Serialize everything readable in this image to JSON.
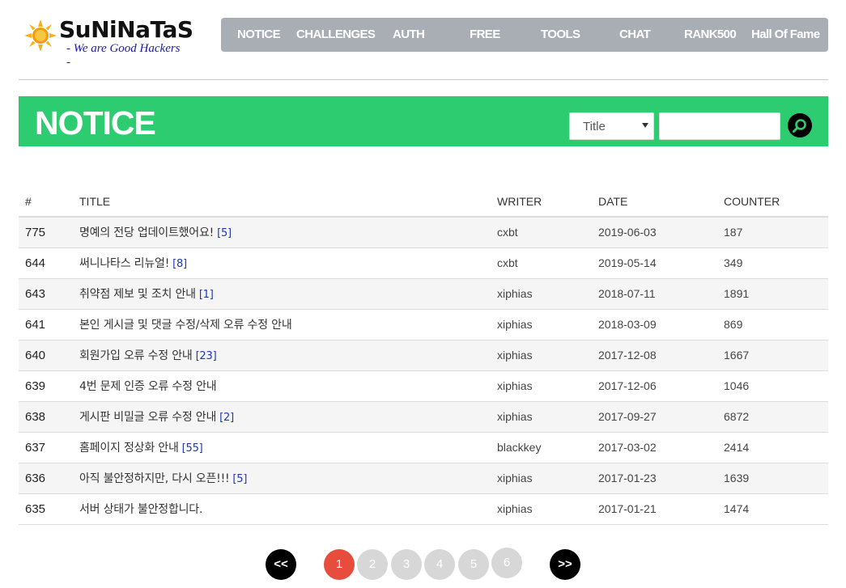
{
  "site": {
    "brand": "SuNiNaTaS",
    "tagline": "- We are Good Hackers -"
  },
  "nav": {
    "items": [
      "NOTICE",
      "CHALLENGES",
      "AUTH",
      "FREE",
      "TOOLS",
      "CHAT",
      "RANK500",
      "Hall Of Fame"
    ]
  },
  "page": {
    "title": "NOTICE"
  },
  "search": {
    "field_selected": "Title",
    "query": ""
  },
  "table": {
    "headers": [
      "#",
      "TITLE",
      "WRITER",
      "DATE",
      "COUNTER"
    ],
    "rows": [
      {
        "num": "775",
        "title": "명예의 전당 업데이트했어요!",
        "comments": "[5]",
        "writer": "cxbt",
        "date": "2019-06-03",
        "counter": "187"
      },
      {
        "num": "644",
        "title": "써니나타스 리뉴얼!",
        "comments": "[8]",
        "writer": "cxbt",
        "date": "2019-05-14",
        "counter": "349"
      },
      {
        "num": "643",
        "title": "취약점 제보 및 조치 안내",
        "comments": "[1]",
        "writer": "xiphias",
        "date": "2018-07-11",
        "counter": "1891"
      },
      {
        "num": "641",
        "title": "본인 게시글 및 댓글 수정/삭제 오류 수정 안내",
        "comments": "",
        "writer": "xiphias",
        "date": "2018-03-09",
        "counter": "869"
      },
      {
        "num": "640",
        "title": "회원가입 오류 수정 안내",
        "comments": "[23]",
        "writer": "xiphias",
        "date": "2017-12-08",
        "counter": "1667"
      },
      {
        "num": "639",
        "title": "4번 문제 인증 오류 수정 안내",
        "comments": "",
        "writer": "xiphias",
        "date": "2017-12-06",
        "counter": "1046"
      },
      {
        "num": "638",
        "title": "게시판 비밀글 오류 수정 안내",
        "comments": "[2]",
        "writer": "xiphias",
        "date": "2017-09-27",
        "counter": "6872"
      },
      {
        "num": "637",
        "title": "홈페이지 정상화 안내",
        "comments": "[55]",
        "writer": "blackkey",
        "date": "2017-03-02",
        "counter": "2414"
      },
      {
        "num": "636",
        "title": "아직 불안정하지만, 다시 오픈!!!",
        "comments": "[5]",
        "writer": "xiphias",
        "date": "2017-01-23",
        "counter": "1639"
      },
      {
        "num": "635",
        "title": "서버 상태가 불안정합니다.",
        "comments": "",
        "writer": "xiphias",
        "date": "2017-01-21",
        "counter": "1474"
      }
    ]
  },
  "pagination": {
    "prev": "<<",
    "next": ">>",
    "pages": [
      "1",
      "2",
      "3",
      "4",
      "5",
      "6"
    ],
    "current": "1"
  },
  "colors": {
    "accent_green": "#2ecc71",
    "nav_bg": "#a9aeb5",
    "active_page": "#e74c3c",
    "comment_link": "#1a37b7"
  }
}
